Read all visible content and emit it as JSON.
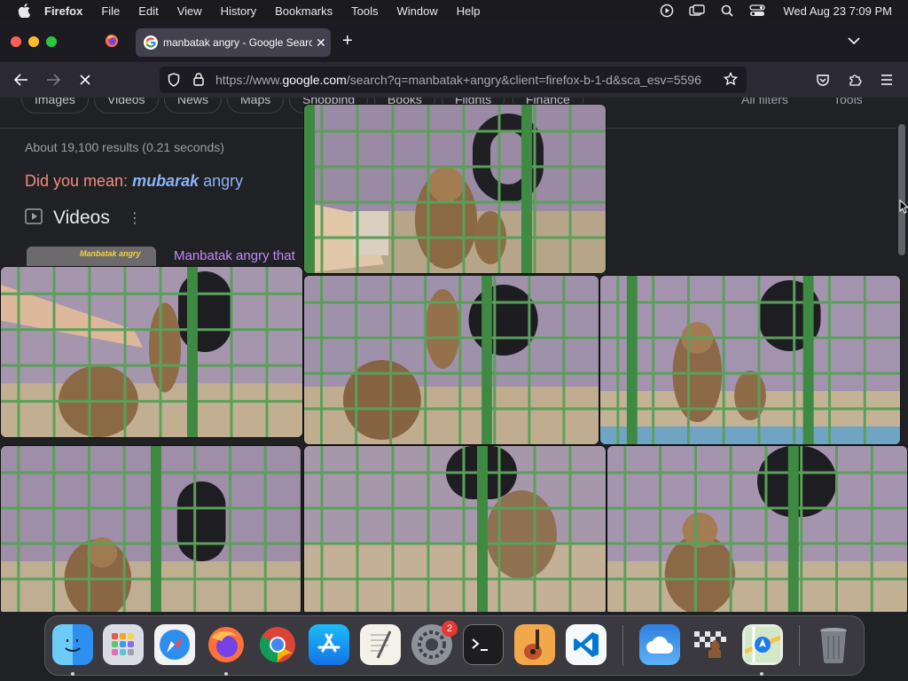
{
  "menubar": {
    "apple_icon": "apple-icon",
    "app_name": "Firefox",
    "items": [
      "File",
      "Edit",
      "View",
      "History",
      "Bookmarks",
      "Tools",
      "Window",
      "Help"
    ],
    "clock": "Wed Aug 23  7:09 PM",
    "status_icons": [
      "play-circle-icon",
      "screen-mirroring-icon",
      "search-icon",
      "control-center-icon"
    ]
  },
  "browser": {
    "tab": {
      "title": "manbatak angry - Google Search",
      "favicon": "google-icon"
    },
    "url": {
      "prefix": "https://www.",
      "domain": "google.com",
      "path": "/search?q=manbatak+angry&client=firefox-b-1-d&sca_esv=5596"
    },
    "colors": {
      "chrome": "#2b2a33",
      "tabbar": "#1c1b22",
      "page": "#202124"
    }
  },
  "page": {
    "chips": [
      "Images",
      "Videos",
      "News",
      "Maps",
      "Shopping",
      "Books",
      "Flights",
      "Finance"
    ],
    "all_filters": "All filters",
    "tools": "Tools",
    "results_stats": "About 19,100 results (0.21 seconds)",
    "did_you_mean": {
      "prefix": "Did you mean: ",
      "bold": "mubarak",
      "rest": " angry"
    },
    "videos_heading": "Videos",
    "video_thumb_text": "Manbatak angry",
    "video_link": "Manbatak angry that"
  },
  "dock": {
    "apps": [
      "Finder",
      "Launchpad",
      "Safari",
      "Firefox",
      "Google Chrome",
      "App Store",
      "TextEdit",
      "System Settings",
      "Terminal",
      "GarageBand",
      "Visual Studio Code",
      "Weather",
      "Chess",
      "Maps",
      "Trash"
    ],
    "settings_badge": "2"
  }
}
